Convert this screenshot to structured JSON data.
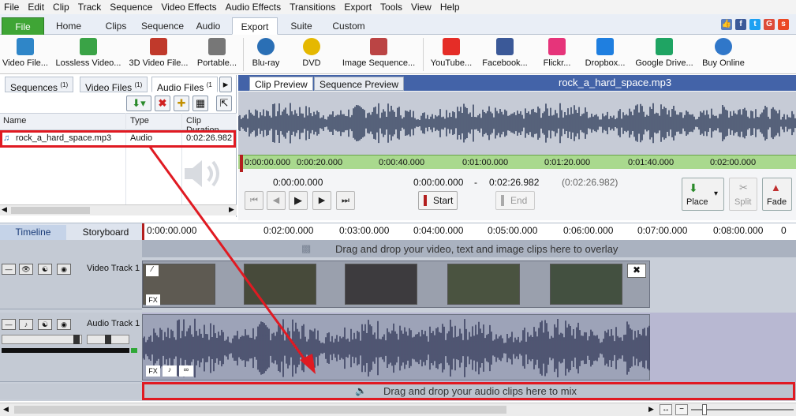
{
  "menu": [
    "File",
    "Edit",
    "Clip",
    "Track",
    "Sequence",
    "Video Effects",
    "Audio Effects",
    "Transitions",
    "Export",
    "Tools",
    "View",
    "Help"
  ],
  "ribbon_tabs": [
    "File",
    "Home",
    "Clips",
    "Sequence",
    "Audio",
    "Export",
    "Suite",
    "Custom"
  ],
  "active_ribbon_tab": "Export",
  "toolbar": [
    "Video File...",
    "Lossless Video...",
    "3D Video File...",
    "Portable...",
    "Blu-ray",
    "DVD",
    "Image Sequence...",
    "YouTube...",
    "Facebook...",
    "Flickr...",
    "Dropbox...",
    "Google Drive...",
    "Buy Online"
  ],
  "panel": {
    "tabs": [
      {
        "label": "Sequences",
        "count": "(1)"
      },
      {
        "label": "Video Files",
        "count": "(1)"
      },
      {
        "label": "Audio Files",
        "count": "(1"
      }
    ],
    "columns": {
      "name": "Name",
      "type": "Type",
      "duration": "Clip Duration"
    },
    "row": {
      "name": "rock_a_hard_space.mp3",
      "type": "Audio",
      "duration": "0:02:26.982"
    }
  },
  "preview": {
    "tabs": [
      "Clip Preview",
      "Sequence Preview"
    ],
    "filename": "rock_a_hard_space.mp3",
    "ruler": [
      "0:00:00.000",
      "0:00:20.000",
      "0:00:40.000",
      "0:01:00.000",
      "0:01:20.000",
      "0:01:40.000",
      "0:02:00.000"
    ],
    "position": "0:00:00.000",
    "start_time": "0:00:00.000",
    "dash": "-",
    "end_time": "0:02:26.982",
    "duration": "(0:02:26.982)",
    "start_label": "Start",
    "end_label": "End",
    "place_label": "Place",
    "split_label": "Split",
    "fade_label": "Fade"
  },
  "timeline": {
    "tabs": [
      "Timeline",
      "Storyboard"
    ],
    "ruler": [
      "0:00:00.000",
      "0:02:00.000",
      "0:03:00.000",
      "0:04:00.000",
      "0:05:00.000",
      "0:06:00.000",
      "0:07:00.000",
      "0:08:00.000"
    ],
    "overlay_hint": "Drag and drop your video, text and image clips here to overlay",
    "video_track_label": "Video Track 1",
    "audio_track_label": "Audio Track 1",
    "mix_hint": "Drag and drop your audio clips here to mix",
    "fx_label": "FX"
  },
  "colors": {
    "annotation_red": "#e01a22",
    "file_tab_green": "#3fa535",
    "preview_header_blue": "#4363a8"
  }
}
